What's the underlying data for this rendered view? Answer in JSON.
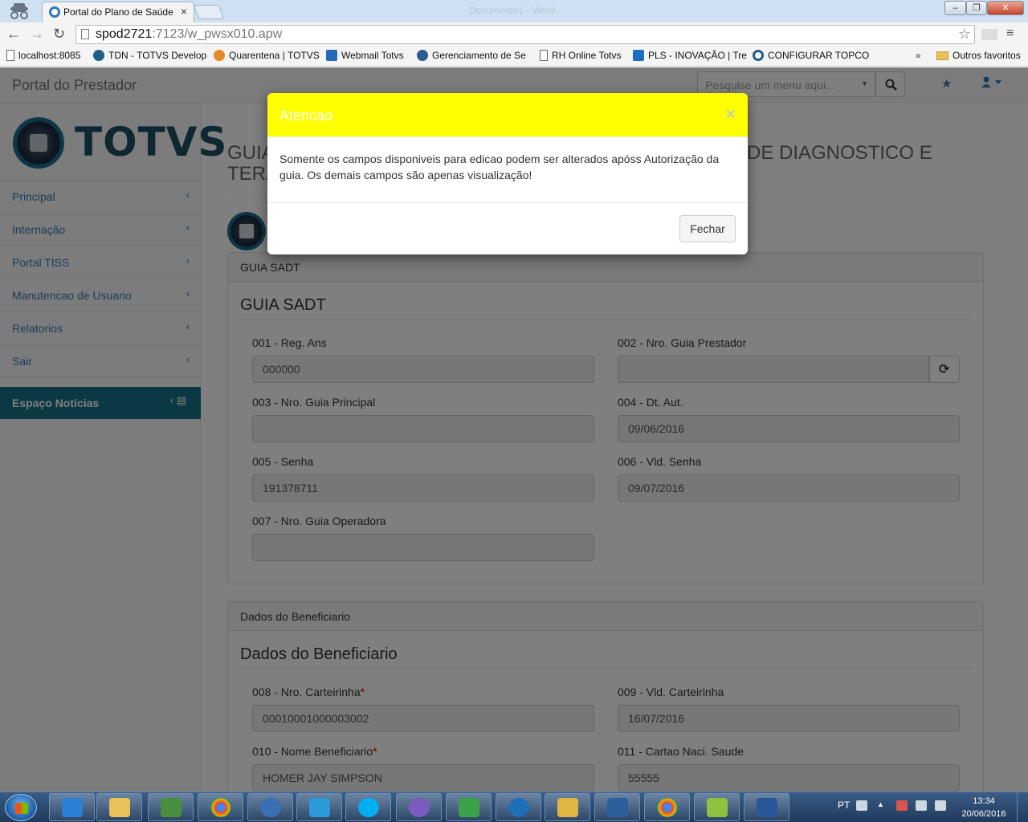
{
  "browser": {
    "tab_title": "Portal do Plano de Saúde",
    "tab_close": "×",
    "window_title": "Documento1 - Word",
    "url_host": "spod2721",
    "url_rest": ":7123/w_pwsx010.apw",
    "bookmarks": [
      {
        "label": "localhost:8085",
        "color": "#ffffff"
      },
      {
        "label": "TDN - TOTVS Develop",
        "color": "#1d5f87"
      },
      {
        "label": "Quarentena | TOTVS",
        "color": "#e58a2a"
      },
      {
        "label": "Webmail Totvs",
        "color": "#2568b8"
      },
      {
        "label": "Gerenciamento de Se",
        "color": "#2b5c8f"
      },
      {
        "label": "RH Online Totvs",
        "color": "#ffffff"
      },
      {
        "label": "PLS - INOVAÇÃO | Tre",
        "color": "#1c6dc4"
      },
      {
        "label": "CONFIGURAR TOPCO",
        "color": "#1d5f87"
      }
    ],
    "bookmarks_more": "»",
    "other_bookmarks": "Outros favoritos"
  },
  "navbar": {
    "brand": "Portal do Prestador",
    "search_placeholder": "Pesquise um menu aqui..."
  },
  "sidebar": {
    "logo_text": "TOTVS",
    "items": [
      {
        "label": "Principal"
      },
      {
        "label": "Internação"
      },
      {
        "label": "Portal TISS"
      },
      {
        "label": "Manutencao de Usuario"
      },
      {
        "label": "Relatorios"
      },
      {
        "label": "Sair"
      }
    ],
    "news": "Espaço Notícias"
  },
  "main": {
    "heading_left": "GUIA",
    "heading_left2": "TERA",
    "heading_right": "DE DIAGNOSTICO E",
    "guia_panel": {
      "header": "GUIA SADT",
      "title": "GUIA SADT",
      "fields": [
        {
          "label": "001 - Reg. Ans",
          "value": "000000"
        },
        {
          "label": "002 - Nro. Guia Prestador",
          "value": ""
        },
        {
          "label": "003 - Nro. Guia Principal",
          "value": ""
        },
        {
          "label": "004 - Dt. Aut.",
          "value": "09/06/2016"
        },
        {
          "label": "005 - Senha",
          "value": "191378711"
        },
        {
          "label": "006 - Vld. Senha",
          "value": "09/07/2016"
        },
        {
          "label": "007 - Nro. Guia Operadora",
          "value": ""
        }
      ]
    },
    "benef_panel": {
      "header": "Dados do Beneficiario",
      "title": "Dados do Beneficiario",
      "fields": [
        {
          "label": "008 - Nro. Carteirinha",
          "required": "*",
          "value": "00010001000003002"
        },
        {
          "label": "009 - Vld. Carteirinha",
          "value": "16/07/2016"
        },
        {
          "label": "010 - Nome Beneficiario",
          "required": "*",
          "value": "HOMER JAY SIMPSON"
        },
        {
          "label": "011 - Cartao Naci. Saude",
          "value": "55555"
        }
      ]
    }
  },
  "modal": {
    "title": "Atencao",
    "close_x": "×",
    "message": "Somente os campos disponiveis para edicao podem ser alterados apóss Autorização da guia. Os demais campos são apenas visualização!",
    "button": "Fechar",
    "header_color": "#ffff00"
  },
  "taskbar": {
    "language": "PT",
    "time": "13:34",
    "date": "20/06/2016"
  }
}
